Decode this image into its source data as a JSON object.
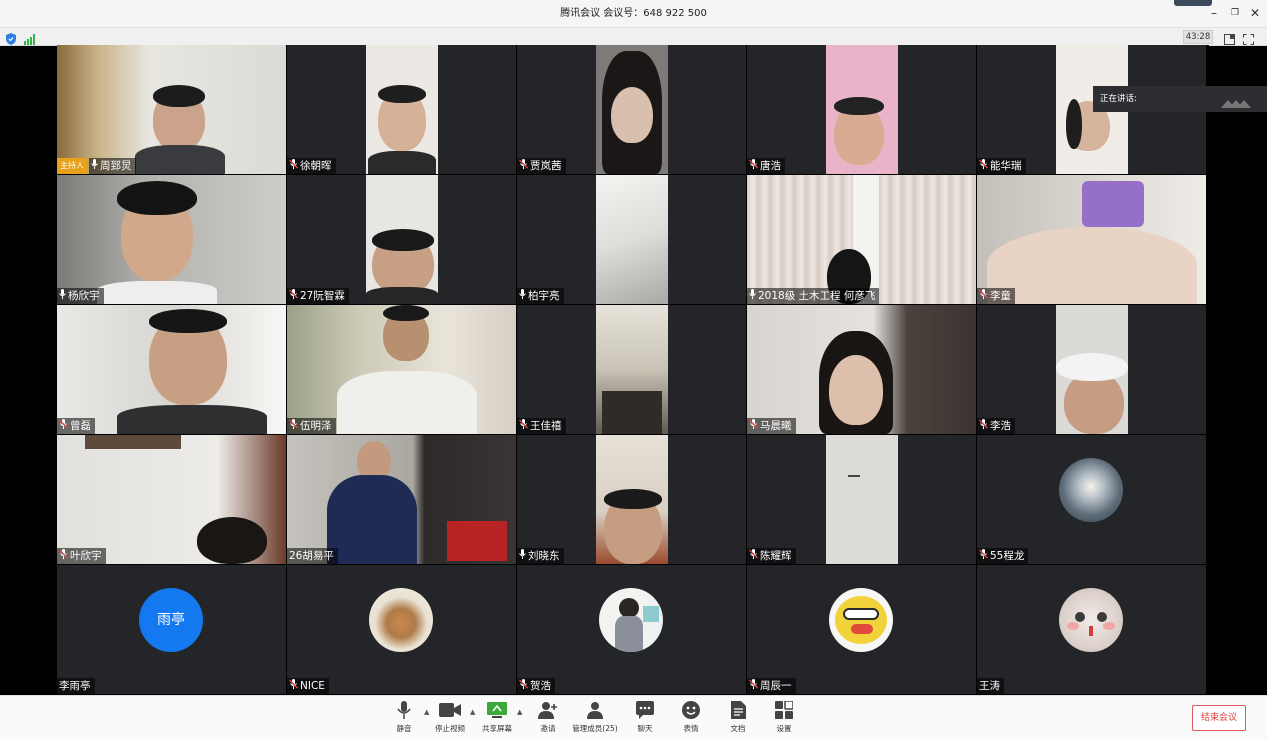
{
  "window": {
    "title": "腾讯会议 会议号：648 922 500",
    "timer": "43:28"
  },
  "speaking": {
    "label": "正在讲话:"
  },
  "host_tag": "主持人",
  "participants": [
    {
      "name": "周郅炅",
      "mic": "on"
    },
    {
      "name": "徐朝晖",
      "mic": "muted"
    },
    {
      "name": "贾岚茜",
      "mic": "muted"
    },
    {
      "name": "唐浩",
      "mic": "muted"
    },
    {
      "name": "能华瑞",
      "mic": "muted"
    },
    {
      "name": "杨欣宇",
      "mic": "on"
    },
    {
      "name": "27阮智霖",
      "mic": "muted"
    },
    {
      "name": "柏宇亮",
      "mic": "on"
    },
    {
      "name": "2018级 土木工程 何彦飞",
      "mic": "on"
    },
    {
      "name": "李童",
      "mic": "muted"
    },
    {
      "name": "曾磊",
      "mic": "muted"
    },
    {
      "name": "伍明泽",
      "mic": "muted"
    },
    {
      "name": "王佳禧",
      "mic": "muted"
    },
    {
      "name": "马晨曦",
      "mic": "muted"
    },
    {
      "name": "李浩",
      "mic": "muted"
    },
    {
      "name": "叶欣宇",
      "mic": "muted"
    },
    {
      "name": "26胡易平",
      "mic": "none"
    },
    {
      "name": "刘晓东",
      "mic": "on"
    },
    {
      "name": "陈耀辉",
      "mic": "muted"
    },
    {
      "name": "55程龙",
      "mic": "muted"
    },
    {
      "name": "李雨亭",
      "mic": "none",
      "avatar_text": "雨亭"
    },
    {
      "name": "NICE",
      "mic": "muted"
    },
    {
      "name": "贺浩",
      "mic": "muted"
    },
    {
      "name": "周辰一",
      "mic": "muted"
    },
    {
      "name": "王涛",
      "mic": "none"
    }
  ],
  "toolbar": {
    "mute": "静音",
    "stop_video": "停止视频",
    "share_screen": "共享屏幕",
    "invite": "邀请",
    "manage_members": "管理成员(25)",
    "chat": "聊天",
    "reactions": "表情",
    "docs": "文档",
    "settings": "设置",
    "end_meeting": "结束会议"
  }
}
